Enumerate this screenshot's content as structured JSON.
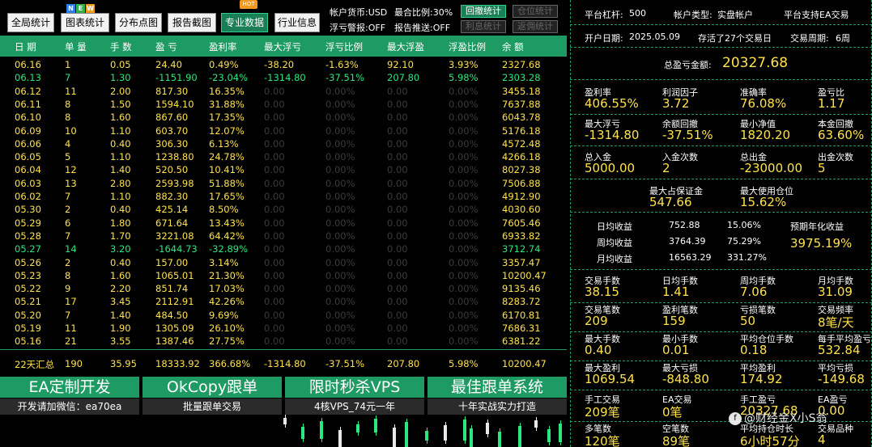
{
  "topbar": {
    "buttons": [
      "全局统计",
      "图表统计",
      "分布点图",
      "报告截图",
      "专业数据",
      "行业信息"
    ],
    "new_badge": [
      "N",
      "E",
      "W"
    ],
    "hot_badge": "HOT",
    "account_currency": "帐户货币:USD",
    "max_ratio": "最合比例:30%",
    "float_alert": "浮亏警报:OFF",
    "report_push": "报告推送:OFF",
    "btn_drawdown": "回撤统计",
    "btn_position": "仓位统计",
    "btn_interest": "利息统计",
    "btn_rebate": "返佣统计"
  },
  "table": {
    "headers": [
      "日 期",
      "单 量",
      "手 数",
      "盈 亏",
      "盈利率",
      "最大浮亏",
      "浮亏比例",
      "最大浮盈",
      "浮盈比例",
      "余 额"
    ],
    "rows": [
      [
        "06.16",
        "1",
        "0.05",
        "24.40",
        "0.49%",
        "-38.20",
        "-1.63%",
        "92.10",
        "3.93%",
        "2327.68"
      ],
      [
        "06.13",
        "7",
        "1.30",
        "-1151.90",
        "-23.04%",
        "-1314.80",
        "-37.51%",
        "207.80",
        "5.98%",
        "2303.28"
      ],
      [
        "06.12",
        "11",
        "2.00",
        "817.30",
        "16.35%",
        "0.00",
        "0.00%",
        "0.00",
        "0.00%",
        "3455.18"
      ],
      [
        "06.11",
        "8",
        "1.50",
        "1594.10",
        "31.88%",
        "0.00",
        "0.00%",
        "0.00",
        "0.00%",
        "7637.88"
      ],
      [
        "06.10",
        "8",
        "1.60",
        "867.60",
        "17.35%",
        "0.00",
        "0.00%",
        "0.00",
        "0.00%",
        "6043.78"
      ],
      [
        "06.09",
        "10",
        "1.10",
        "603.70",
        "12.07%",
        "0.00",
        "0.00%",
        "0.00",
        "0.00%",
        "5176.18"
      ],
      [
        "06.06",
        "4",
        "0.40",
        "306.30",
        "6.13%",
        "0.00",
        "0.00%",
        "0.00",
        "0.00%",
        "4572.48"
      ],
      [
        "06.05",
        "5",
        "1.10",
        "1238.80",
        "24.78%",
        "0.00",
        "0.00%",
        "0.00",
        "0.00%",
        "4266.18"
      ],
      [
        "06.04",
        "12",
        "1.40",
        "520.50",
        "10.41%",
        "0.00",
        "0.00%",
        "0.00",
        "0.00%",
        "8027.38"
      ],
      [
        "06.03",
        "13",
        "2.80",
        "2593.98",
        "51.88%",
        "0.00",
        "0.00%",
        "0.00",
        "0.00%",
        "7506.88"
      ],
      [
        "06.02",
        "7",
        "1.10",
        "882.30",
        "17.65%",
        "0.00",
        "0.00%",
        "0.00",
        "0.00%",
        "4912.90"
      ],
      [
        "05.30",
        "2",
        "0.40",
        "425.14",
        "8.50%",
        "0.00",
        "0.00%",
        "0.00",
        "0.00%",
        "4030.60"
      ],
      [
        "05.29",
        "6",
        "1.80",
        "671.64",
        "13.43%",
        "0.00",
        "0.00%",
        "0.00",
        "0.00%",
        "7605.46"
      ],
      [
        "05.28",
        "7",
        "1.70",
        "3221.08",
        "64.42%",
        "0.00",
        "0.00%",
        "0.00",
        "0.00%",
        "6933.82"
      ],
      [
        "05.27",
        "14",
        "3.20",
        "-1644.73",
        "-32.89%",
        "0.00",
        "0.00%",
        "0.00",
        "0.00%",
        "3712.74"
      ],
      [
        "05.26",
        "2",
        "0.40",
        "157.00",
        "3.14%",
        "0.00",
        "0.00%",
        "0.00",
        "0.00%",
        "3357.47"
      ],
      [
        "05.23",
        "8",
        "1.60",
        "1065.01",
        "21.30%",
        "0.00",
        "0.00%",
        "0.00",
        "0.00%",
        "10200.47"
      ],
      [
        "05.22",
        "9",
        "2.20",
        "851.74",
        "17.03%",
        "0.00",
        "0.00%",
        "0.00",
        "0.00%",
        "9135.46"
      ],
      [
        "05.21",
        "17",
        "3.45",
        "2112.91",
        "42.26%",
        "0.00",
        "0.00%",
        "0.00",
        "0.00%",
        "8283.72"
      ],
      [
        "05.20",
        "7",
        "1.40",
        "484.50",
        "9.69%",
        "0.00",
        "0.00%",
        "0.00",
        "0.00%",
        "6170.81"
      ],
      [
        "05.19",
        "11",
        "1.90",
        "1305.09",
        "26.10%",
        "0.00",
        "0.00%",
        "0.00",
        "0.00%",
        "7686.31"
      ],
      [
        "05.16",
        "21",
        "3.55",
        "1387.46",
        "27.75%",
        "0.00",
        "0.00%",
        "0.00",
        "0.00%",
        "6381.22"
      ]
    ],
    "summary": [
      "22天汇总",
      "190",
      "35.95",
      "18333.92",
      "366.68%",
      "-1314.80",
      "-37.51%",
      "207.80",
      "5.98%",
      "10200.47"
    ]
  },
  "promos": [
    {
      "title": "EA定制开发",
      "sub": "开发请加微信：ea70ea"
    },
    {
      "title": "OkCopy跟单",
      "sub": "批量跟单交易"
    },
    {
      "title": "限时秒杀VPS",
      "sub": "4核VPS_74元一年"
    },
    {
      "title": "最佳跟单系统",
      "sub": "十年实战实力打造"
    }
  ],
  "right": {
    "leverage_label": "平台杠杆:",
    "leverage": "500",
    "acct_type_label": "帐户类型:",
    "acct_type": "实盘帐户",
    "platform_ea": "平台支持EA交易",
    "open_date_label": "开户日期:",
    "open_date": "2025.05.09",
    "survive": "存活了27个交易日",
    "cycle_label": "交易周期:",
    "cycle": "6周",
    "total_pnl_label": "总盈亏金额:",
    "total_pnl": "20327.68",
    "r1": [
      [
        "盈利率",
        "406.55%"
      ],
      [
        "利润因子",
        "3.72"
      ],
      [
        "准确率",
        "76.08%"
      ],
      [
        "盈亏比",
        "1.17"
      ]
    ],
    "r2": [
      [
        "最大浮亏",
        "-1314.80"
      ],
      [
        "余额回撤",
        "-37.51%"
      ],
      [
        "最小净值",
        "1820.20"
      ],
      [
        "本金回撤",
        "63.60%"
      ]
    ],
    "r3": [
      [
        "总入金",
        "5000.00"
      ],
      [
        "入金次数",
        "2"
      ],
      [
        "总出金",
        "-23000.00"
      ],
      [
        "出金次数",
        "5"
      ]
    ],
    "r4": [
      [
        "最大占保证金",
        "547.66"
      ],
      [
        "最大使用仓位",
        "15.62%"
      ]
    ],
    "income": [
      [
        "日均收益",
        "752.88",
        "15.06%"
      ],
      [
        "周均收益",
        "3764.39",
        "75.29%"
      ],
      [
        "月均收益",
        "16563.29",
        "331.27%"
      ]
    ],
    "annual_label": "预期年化收益",
    "annual": "3975.19%",
    "r5": [
      [
        "交易手数",
        "38.15"
      ],
      [
        "日均手数",
        "1.41"
      ],
      [
        "周均手数",
        "7.06"
      ],
      [
        "月均手数",
        "31.09"
      ]
    ],
    "r6": [
      [
        "交易笔数",
        "209"
      ],
      [
        "盈利笔数",
        "159"
      ],
      [
        "亏损笔数",
        "50"
      ],
      [
        "交易频率",
        "8笔/天"
      ]
    ],
    "r7": [
      [
        "最大手数",
        "0.40"
      ],
      [
        "最小手数",
        "0.01"
      ],
      [
        "平均仓位手数",
        "0.18"
      ],
      [
        "每手平均盈亏",
        "532.84"
      ]
    ],
    "r8": [
      [
        "最大盈利",
        "1069.54"
      ],
      [
        "最大亏损",
        "-848.80"
      ],
      [
        "平均盈利",
        "174.92"
      ],
      [
        "平均亏损",
        "-149.68"
      ]
    ],
    "r9": [
      [
        "手工交易",
        "209笔"
      ],
      [
        "EA交易",
        "0笔"
      ],
      [
        "手工盈亏",
        "20327.68"
      ],
      [
        "EA盈亏",
        "0.00"
      ]
    ],
    "r10": [
      [
        "多笔数",
        "120笔"
      ],
      [
        "空笔数",
        "89笔"
      ],
      [
        "平均持仓时长",
        "6小时57分"
      ],
      [
        "交易品种",
        "4"
      ]
    ],
    "watermark": "@财经金X小S翁"
  }
}
